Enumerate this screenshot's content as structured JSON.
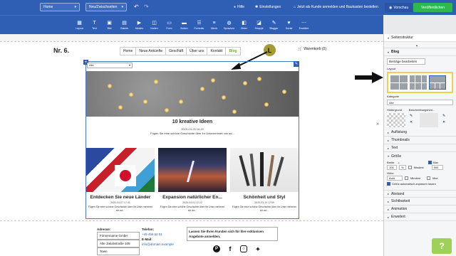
{
  "topbar": {
    "page_select": "Home",
    "new_page": "Neu/Zwischseiten",
    "help": "Hilfe",
    "settings": "Einstellungen",
    "promo": "Jetzt als Kunde anmelden und Baukasten bestellen",
    "preview": "Vorschau",
    "publish": "Veröffentlichen"
  },
  "toolbar": [
    {
      "icon": "layout-icon",
      "label": "Layout"
    },
    {
      "icon": "text-icon",
      "label": "Text"
    },
    {
      "icon": "image-icon",
      "label": "Bild"
    },
    {
      "icon": "gallery-icon",
      "label": "Galerie"
    },
    {
      "icon": "media-icon",
      "label": "Medien"
    },
    {
      "icon": "map-icon",
      "label": "Karten"
    },
    {
      "icon": "form-icon",
      "label": "Form"
    },
    {
      "icon": "button-icon",
      "label": "Button"
    },
    {
      "icon": "formula-icon",
      "label": "Formular"
    },
    {
      "icon": "menu-icon",
      "label": "Menü"
    },
    {
      "icon": "language-icon",
      "label": "Sprachen"
    },
    {
      "icon": "slider-icon",
      "label": "Slider"
    },
    {
      "icon": "shop-icon",
      "label": "Shop/pt"
    },
    {
      "icon": "blog-icon",
      "label": "Blogger"
    },
    {
      "icon": "social-icon",
      "label": "Sozial"
    },
    {
      "icon": "extras-icon",
      "label": "Erweitert"
    }
  ],
  "site": {
    "logo": "Nr. 6.",
    "nav": [
      "Home",
      "Neue Ankünfte",
      "Geschäft",
      "Über uns",
      "Kontakt",
      "Blog"
    ],
    "cart": "Warenkorb (0)",
    "marker": "L",
    "filter": "Alle"
  },
  "hero": {
    "title": "10 kreative Ideen",
    "date": "2020-04-25 16:20",
    "desc": "Fügen Sie eine schöne Geschichte über Ihr Unternehmen ein ad..."
  },
  "cards": [
    {
      "title": "Entdecken Sie neue Länder",
      "date": "2020-04-07 17:41",
      "desc": "Fügen Sie eine schöne Geschichte über Ihr Unte rnehmen ein ad..."
    },
    {
      "title": "Expansion natürlicher En...",
      "date": "2020-04-01 12:22",
      "desc": "Fügen Sie eine schöne Geschichte über Ihr Unte rnehmen ein ad..."
    },
    {
      "title": "Schönheit und Styl",
      "date": "2020-03-10 12:09",
      "desc": "Fügen Sie eine schöne Geschichte über Ihr Unte rnehmen ein ad..."
    }
  ],
  "footer": {
    "address_h": "Adresse:",
    "address": [
      "Firmenname GmbH",
      "Alte Jakobstraße 105",
      "Town"
    ],
    "phone_h": "Telefon:",
    "phone": "+49 456 52 81",
    "email_h": "E-Mail:",
    "email": "info@domain.example",
    "cta": "Lassen Sie Ihren Kunden sich für Ihre exklusiven Angebote anmelden."
  },
  "panel": {
    "title": "Seitenstruktur",
    "section": "Blog",
    "edit_btn": "Beiträge bearbeiten",
    "layout_label": "Layout",
    "category_label": "Kategorie",
    "category_value": "Alle",
    "bg_label": "Hintergrund",
    "desc_bg_label": "Beschreibungshint...",
    "sections": [
      "Auflistung",
      "Thumbnails",
      "Text"
    ],
    "size": "Größe",
    "width_label": "Breite",
    "width_value": "100",
    "width_unit": "%",
    "min_label": "Mindest",
    "max_label": "Max",
    "max_value": "990",
    "height_label": "Höhe",
    "height_value": "Auto",
    "auto_size": "Größe automatisch anpassen lassen",
    "sections2": [
      "Abstand",
      "Sichtbarkeit",
      "Animation",
      "Erweitert"
    ]
  },
  "help_btn": "?"
}
